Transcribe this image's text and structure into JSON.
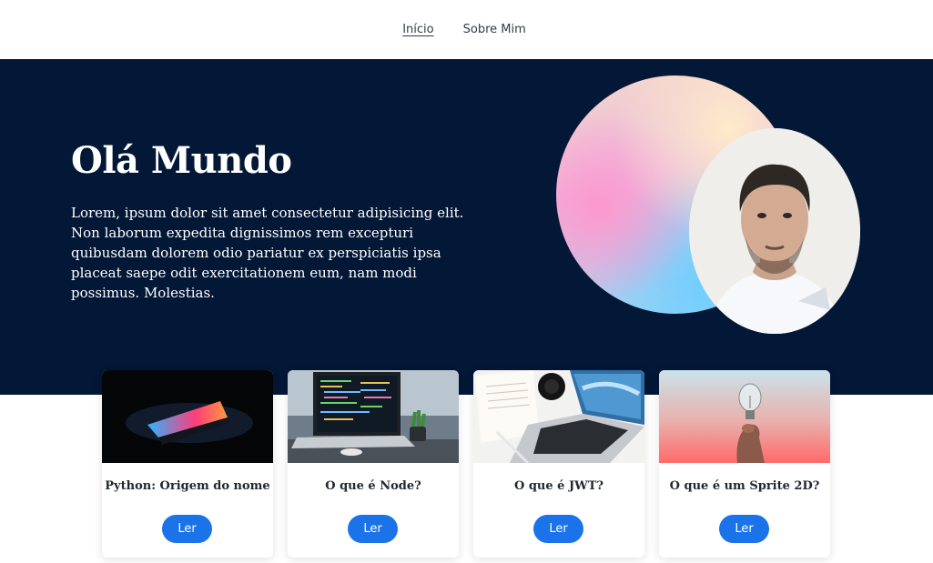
{
  "nav": {
    "items": [
      {
        "label": "Início",
        "active": true
      },
      {
        "label": "Sobre Mim",
        "active": false
      }
    ]
  },
  "hero": {
    "title": "Olá Mundo",
    "text": "Lorem, ipsum dolor sit amet consectetur adipisicing elit. Non laborum expedita dignissimos rem excepturi quibusdam dolorem odio pariatur ex perspiciatis ipsa placeat saepe odit exercitationem eum, nam modi possimus. Molestias."
  },
  "posts": [
    {
      "title": "Python: Origem do nome",
      "button": "Ler",
      "image": "laptop-dark-neon"
    },
    {
      "title": "O que é Node?",
      "button": "Ler",
      "image": "laptop-code-plant"
    },
    {
      "title": "O que é JWT?",
      "button": "Ler",
      "image": "laptop-desk-papers"
    },
    {
      "title": "O que é um Sprite 2D?",
      "button": "Ler",
      "image": "hand-lightbulb"
    }
  ],
  "colors": {
    "hero_bg": "#031736",
    "accent": "#1a73e8"
  }
}
